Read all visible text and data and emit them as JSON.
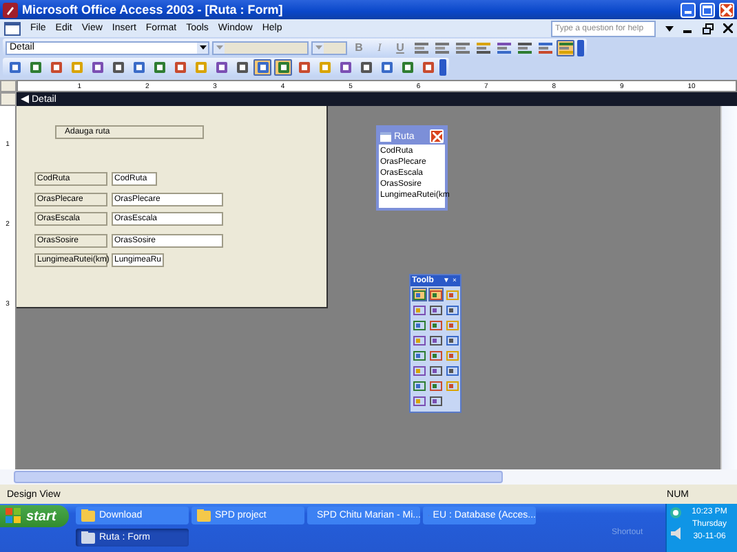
{
  "window": {
    "title": "Microsoft Office Access 2003 - [Ruta : Form]"
  },
  "menu": [
    "File",
    "Edit",
    "View",
    "Insert",
    "Format",
    "Tools",
    "Window",
    "Help"
  ],
  "help_box": {
    "placeholder": "Type a question for help"
  },
  "formatting_toolbar": {
    "object": "Detail",
    "letters": [
      "B",
      "I",
      "U"
    ],
    "buttons": [
      {
        "on": false
      },
      {
        "on": false
      },
      {
        "on": false
      },
      {
        "on": false
      },
      {
        "on": false
      },
      {
        "on": false
      },
      {
        "on": false
      },
      {
        "on": true
      }
    ]
  },
  "design_toolbar": {
    "buttons": [
      {
        "on": false
      },
      {
        "on": false
      },
      {
        "on": false
      },
      {
        "on": false
      },
      {
        "on": false
      },
      {
        "on": false
      },
      {
        "on": false
      },
      {
        "on": false
      },
      {
        "on": false
      },
      {
        "on": false
      },
      {
        "on": false
      },
      {
        "on": false
      },
      {
        "on": true
      },
      {
        "on": true
      },
      {
        "on": false
      },
      {
        "on": false
      },
      {
        "on": false
      },
      {
        "on": false
      },
      {
        "on": false
      },
      {
        "on": false
      },
      {
        "on": false
      }
    ]
  },
  "ruler": {
    "marks": [
      "1",
      "2",
      "3",
      "4",
      "5",
      "6",
      "7",
      "8",
      "9",
      "10"
    ],
    "vertical_marks": [
      "1",
      "2",
      "3"
    ]
  },
  "section": {
    "title": "Detail"
  },
  "form": {
    "caption": "Adauga ruta",
    "fields": [
      {
        "label": "CodRuta",
        "value": "CodRuta"
      },
      {
        "label": "OrasPlecare",
        "value": "OrasPlecare"
      },
      {
        "label": "OrasEscala",
        "value": "OrasEscala"
      },
      {
        "label": "OrasSosire",
        "value": "OrasSosire"
      },
      {
        "label": "LungimeaRutei(km)",
        "value": "LungimeaRu"
      }
    ]
  },
  "field_list": {
    "title": "Ruta",
    "items": [
      "CodRuta",
      "OrasPlecare",
      "OrasEscala",
      "OrasSosire",
      "LungimeaRutei(km"
    ]
  },
  "toolbox": {
    "title": "Toolb",
    "menu": "▼",
    "close": "×",
    "tools": [
      {
        "on": true
      },
      {
        "on": true
      },
      {
        "on": false
      },
      {
        "on": false
      },
      {
        "on": false
      },
      {
        "on": false
      },
      {
        "on": false
      },
      {
        "on": false
      },
      {
        "on": false
      },
      {
        "on": false
      },
      {
        "on": false
      },
      {
        "on": false
      },
      {
        "on": false
      },
      {
        "on": false
      },
      {
        "on": false
      },
      {
        "on": false
      },
      {
        "on": false
      },
      {
        "on": false
      },
      {
        "on": false
      },
      {
        "on": false
      },
      {
        "on": false
      },
      {
        "on": false
      },
      {
        "on": false
      }
    ]
  },
  "status_bar": {
    "mode": "Design View",
    "indicator": "NUM"
  },
  "taskbar": {
    "start": "start",
    "items": [
      {
        "label": "Download",
        "selected": false
      },
      {
        "label": "SPD project",
        "selected": false
      },
      {
        "label": "SPD Chitu Marian - Mi...",
        "selected": false
      },
      {
        "label": "EU : Database (Acces...",
        "selected": false
      },
      {
        "label": "Ruta : Form",
        "selected": true
      }
    ],
    "shortcut": "Shortout",
    "time": "10:23 PM",
    "day": "Thursday",
    "date": "30-11-06"
  }
}
